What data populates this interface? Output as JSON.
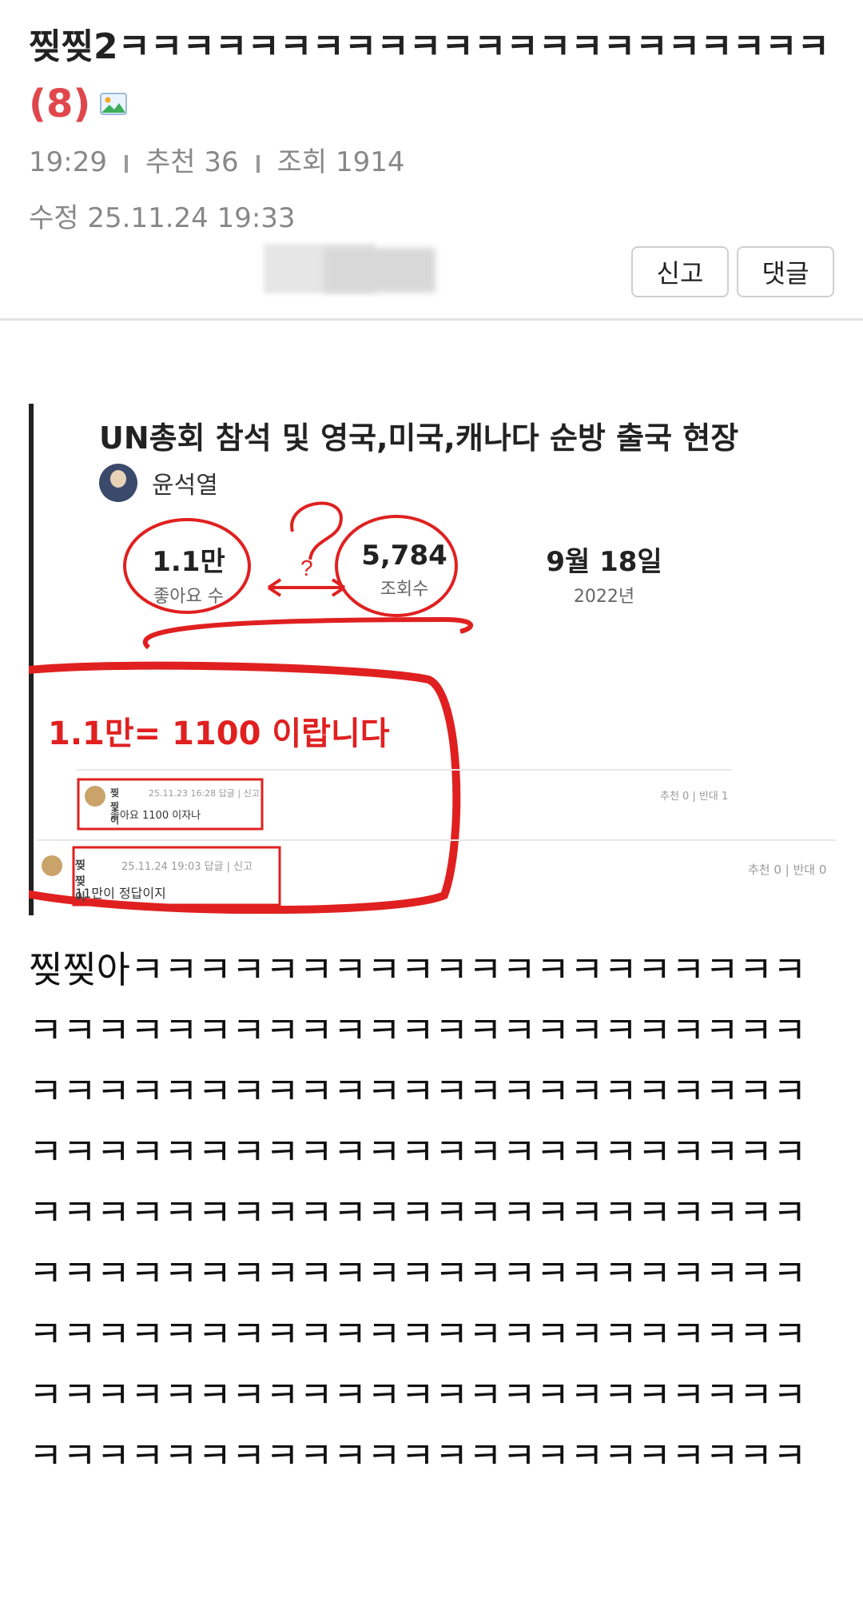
{
  "post": {
    "title": "찢찢2ㅋㅋㅋㅋㅋㅋㅋㅋㅋㅋㅋㅋㅋㅋㅋㅋㅋㅋㅋㅋㅋㅋ",
    "comment_count": "(8)",
    "time": "19:29",
    "recommend": "추천 36",
    "views": "조회 1914",
    "edited": "수정 25.11.24  19:33",
    "report_label": "신고",
    "comment_label": "댓글",
    "body_text": "찢찢아ㅋㅋㅋㅋㅋㅋㅋㅋㅋㅋㅋㅋㅋㅋㅋㅋㅋㅋㅋㅋㅋㅋㅋㅋㅋㅋㅋㅋㅋㅋㅋㅋㅋㅋㅋㅋㅋㅋㅋㅋㅋㅋㅋㅋㅋㅋㅋㅋㅋㅋㅋㅋㅋㅋㅋㅋㅋㅋㅋㅋㅋㅋㅋㅋㅋㅋㅋㅋㅋㅋㅋㅋㅋㅋㅋㅋㅋㅋㅋㅋㅋㅋㅋㅋㅋㅋㅋㅋㅋㅋㅋㅋㅋㅋㅋㅋㅋㅋㅋㅋㅋㅋㅋㅋㅋㅋㅋㅋㅋㅋㅋㅋㅋㅋㅋㅋㅋㅋㅋㅋㅋㅋㅋㅋㅋㅋㅋㅋㅋㅋㅋㅋㅋㅋㅋㅋㅋㅋㅋㅋㅋㅋㅋㅋㅋㅋㅋㅋㅋㅋㅋㅋㅋㅋㅋㅋㅋㅋㅋㅋㅋㅋㅋㅋㅋㅋㅋㅋㅋㅋㅋㅋㅋㅋㅋㅋㅋㅋㅋㅋㅋㅋㅋㅋㅋㅋㅋㅋㅋㅋㅋㅋㅋㅋㅋㅋㅋㅋㅋㅋㅋㅋㅋㅋ"
  },
  "embed": {
    "title": "UN총회 참석 및 영국,미국,캐나다 순방 출국 현장",
    "author": "윤석열",
    "likes_value": "1.1만",
    "likes_label": "좋아요 수",
    "views_value": "5,784",
    "views_label": "조회수",
    "date_value": "9월 18일",
    "date_year": "2022년",
    "question_mark": "?",
    "caption": "1.1만= 1100 이랍니다",
    "comment1": {
      "name": "찢찢이",
      "meta": "25.11.23 16:28  답글 | 신고",
      "text": "좋아요 1100 이자나",
      "votes": "추천 0 | 반대 1"
    },
    "comment2": {
      "name": "찢찢이",
      "meta": "25.11.24 19:03  답글 | 신고",
      "text": "11만이 정답이지",
      "votes": "추천 0 | 반대 0"
    }
  },
  "colors": {
    "accent_red": "#e0474c",
    "scribble_red": "#e02020",
    "meta_gray": "#888888"
  },
  "icons": {
    "image_attachment": "image-icon"
  }
}
